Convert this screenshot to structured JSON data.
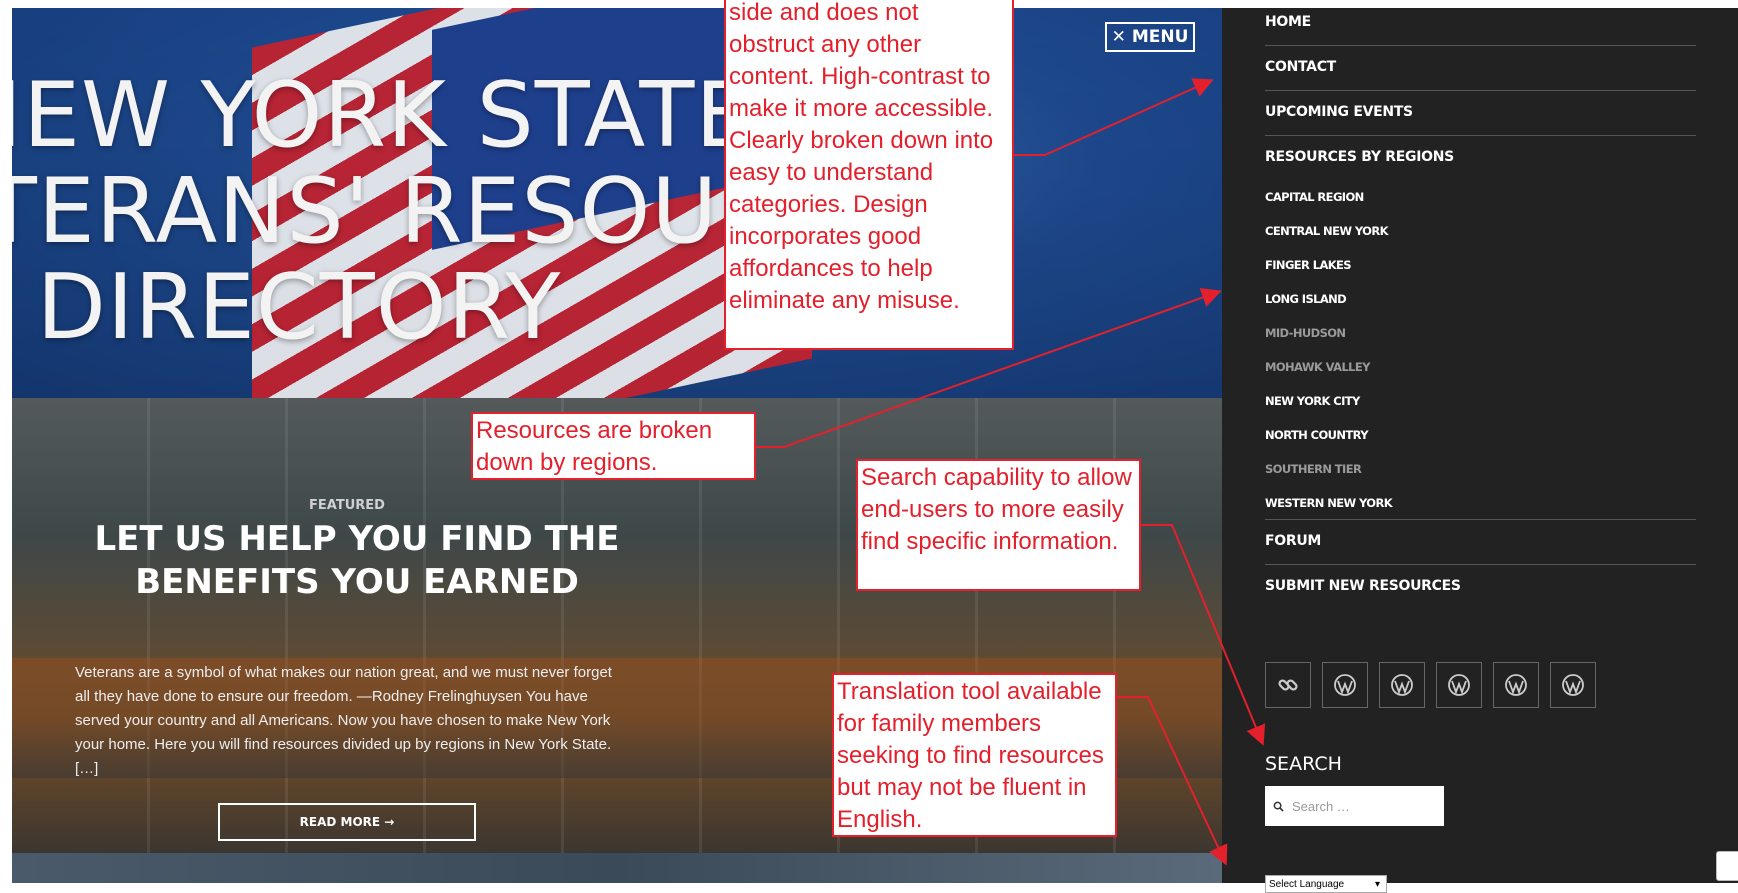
{
  "hero": {
    "title_lines": [
      "NEW YORK STATE",
      "ETERANS' RESOURC",
      "DIRECTORY"
    ],
    "menu_label": "MENU"
  },
  "featured": {
    "label": "FEATURED",
    "title": "LET US HELP YOU FIND THE BENEFITS YOU EARNED",
    "body": "Veterans are a symbol of what makes our nation great, and we must never forget all they have done to ensure our freedom. —Rodney Frelinghuysen You have served your country and all Americans. Now you have chosen to make New York your home. Here you will find resources divided up by regions in New York State. […]",
    "read_more": "READ MORE →"
  },
  "sidebar": {
    "nav": [
      "HOME",
      "CONTACT",
      "UPCOMING EVENTS",
      "RESOURCES BY REGIONS"
    ],
    "regions": [
      {
        "label": "CAPITAL REGION",
        "dim": false
      },
      {
        "label": "CENTRAL NEW YORK",
        "dim": false
      },
      {
        "label": "FINGER LAKES",
        "dim": false
      },
      {
        "label": "LONG ISLAND",
        "dim": false
      },
      {
        "label": "MID-HUDSON",
        "dim": true
      },
      {
        "label": "MOHAWK VALLEY",
        "dim": true
      },
      {
        "label": "NEW YORK CITY",
        "dim": false
      },
      {
        "label": "NORTH COUNTRY",
        "dim": false
      },
      {
        "label": "SOUTHERN TIER",
        "dim": true
      },
      {
        "label": "WESTERN NEW YORK",
        "dim": false
      }
    ],
    "nav_bottom": [
      "FORUM",
      "SUBMIT NEW RESOURCES"
    ],
    "social_icons": [
      "link-icon",
      "wordpress-icon",
      "wordpress-icon",
      "wordpress-icon",
      "wordpress-icon",
      "wordpress-icon"
    ],
    "search_heading": "SEARCH",
    "search_placeholder": "Search …",
    "language_select": "Select Language"
  },
  "annotations": {
    "menu_note": "side and does not obstruct any other content. High-contrast to make it more accessible. Clearly broken down into easy to understand categories. Design incorporates good affordances to help eliminate any misuse.",
    "regions_note": "Resources are broken down by regions.",
    "search_note": "Search capability to allow end-users to more easily find specific information.",
    "translate_note": "Translation tool available for family members seeking to find resources but may not be fluent in English."
  },
  "colors": {
    "annotation_red": "#e3202b",
    "sidebar_bg": "#222222"
  }
}
